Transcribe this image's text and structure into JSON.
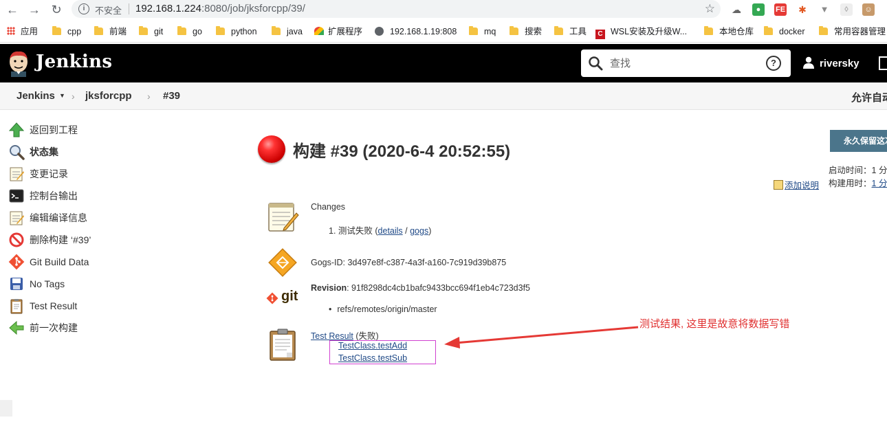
{
  "browser": {
    "insecure_label": "不安全",
    "url_host": "192.168.1.224",
    "url_rest": ":8080/job/jksforcpp/39/",
    "bookmarks": [
      {
        "label": "应用",
        "icon": "apps-icon"
      },
      {
        "label": "cpp",
        "icon": "folder-icon"
      },
      {
        "label": "前端",
        "icon": "folder-icon"
      },
      {
        "label": "git",
        "icon": "folder-icon"
      },
      {
        "label": "go",
        "icon": "folder-icon"
      },
      {
        "label": "python",
        "icon": "folder-icon"
      },
      {
        "label": "java",
        "icon": "folder-icon"
      },
      {
        "label": "扩展程序",
        "icon": "extension-icon"
      },
      {
        "label": "192.168.1.19:808",
        "icon": "globe-icon"
      },
      {
        "label": "mq",
        "icon": "folder-icon"
      },
      {
        "label": "搜索",
        "icon": "folder-icon"
      },
      {
        "label": "工具",
        "icon": "folder-icon"
      },
      {
        "label": "WSL安装及升级W...",
        "icon": "csdn-icon"
      },
      {
        "label": "本地仓库",
        "icon": "folder-icon"
      },
      {
        "label": "docker",
        "icon": "folder-icon"
      },
      {
        "label": "常用容器管理",
        "icon": "folder-icon"
      }
    ]
  },
  "header": {
    "title": "Jenkins",
    "search_placeholder": "查找",
    "help": "?",
    "user": "riversky"
  },
  "breadcrumb": {
    "root": "Jenkins",
    "job": "jksforcpp",
    "build": "#39",
    "right": "允许自动"
  },
  "sidebar": {
    "items": [
      {
        "label": "返回到工程",
        "icon": "up-arrow-icon"
      },
      {
        "label": "状态集",
        "icon": "magnifier-icon"
      },
      {
        "label": "变更记录",
        "icon": "notepad-icon"
      },
      {
        "label": "控制台输出",
        "icon": "terminal-icon"
      },
      {
        "label": "编辑编译信息",
        "icon": "notepad-icon"
      },
      {
        "label": "删除构建 ‘#39’",
        "icon": "no-entry-icon"
      },
      {
        "label": "Git Build Data",
        "icon": "git-icon"
      },
      {
        "label": "No Tags",
        "icon": "save-icon"
      },
      {
        "label": "Test Result",
        "icon": "clipboard-icon"
      },
      {
        "label": "前一次构建",
        "icon": "left-arrow-icon"
      }
    ]
  },
  "build": {
    "title": "构建 #39 (2020-6-4 20:52:55)",
    "status_color": "#cc0000",
    "keep_label": "永久保留这次构建",
    "started_label": "启动时间：",
    "started_value": "1 分",
    "duration_label": "构建用时：",
    "duration_value": "1 分",
    "add_description": "添加说明"
  },
  "changes": {
    "heading": "Changes",
    "item_prefix": "1. 测试失败 (",
    "details": "details",
    "slash": " / ",
    "gogs": "gogs",
    "item_suffix": ")"
  },
  "gogs": {
    "label": "Gogs-ID: 3d497e8f-c387-4a3f-a160-7c919d39b875"
  },
  "git": {
    "logo_text": "git",
    "revision_label": "Revision",
    "revision_value": ": 91f8298dc4cb1bafc9433bcc694f1eb4c723d3f5",
    "branch": "refs/remotes/origin/master"
  },
  "test": {
    "link": "Test Result",
    "status": " (失败)",
    "failures": [
      "TestClass.testAdd",
      "TestClass.testSub"
    ]
  },
  "annotation": {
    "text": "测试结果, 这里是故意将数据写错",
    "color": "#e03030"
  }
}
